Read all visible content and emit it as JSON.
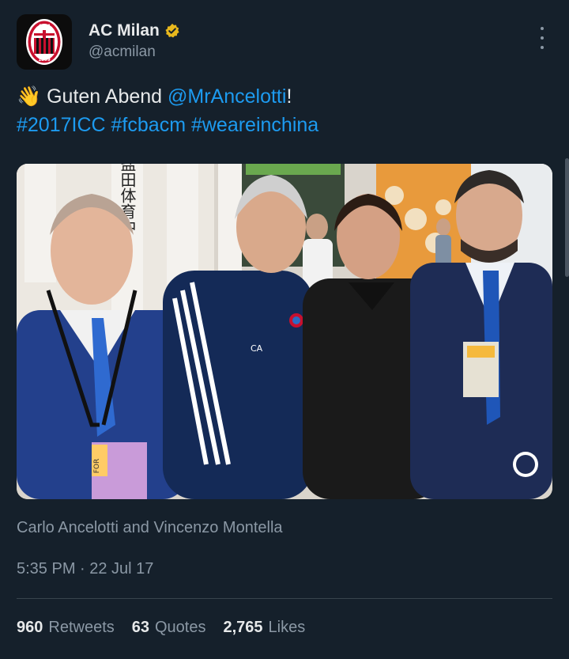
{
  "author": {
    "display_name": "AC Milan",
    "handle": "@acmilan",
    "verified": true,
    "avatar_icon": "ac-milan-crest-icon",
    "avatar_year": "1899",
    "avatar_letters": "ACM"
  },
  "tweet": {
    "emoji": "👋",
    "greeting": "Guten Abend",
    "mention": "@MrAncelotti",
    "after_mention": "!",
    "hashtags": [
      "#2017ICC",
      "#fcbacm",
      "#weareinchina"
    ]
  },
  "media": {
    "type": "photo",
    "signage_text": "圳盐田体育中",
    "jacket_initials": "CA",
    "badge_text": "FOR"
  },
  "caption": "Carlo Ancelotti and Vincenzo Montella",
  "timestamp": "5:35 PM · 22 Jul 17",
  "stats": [
    {
      "count": "960",
      "label": "Retweets"
    },
    {
      "count": "63",
      "label": "Quotes"
    },
    {
      "count": "2,765",
      "label": "Likes"
    }
  ],
  "colors": {
    "background": "#15202b",
    "link": "#1d9bf0",
    "secondary_text": "#8b98a5",
    "verified_badge": "#e8b81d"
  }
}
